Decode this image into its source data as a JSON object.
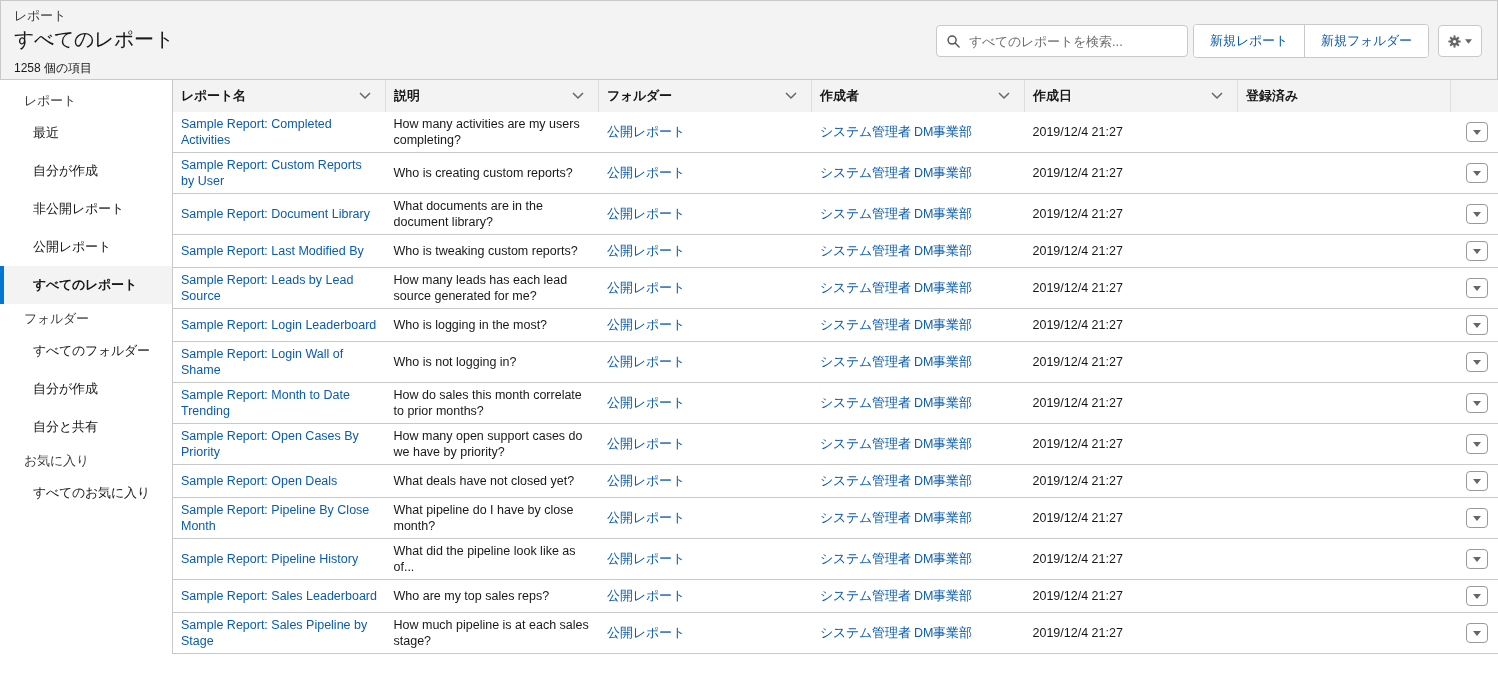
{
  "header": {
    "object_label": "レポート",
    "title": "すべてのレポート",
    "item_count": "1258 個の項目",
    "search": {
      "placeholder": "すべてのレポートを検索..."
    },
    "buttons": [
      "新規レポート",
      "新規フォルダー"
    ]
  },
  "sidebar": {
    "sections": [
      {
        "heading": "レポート",
        "items": [
          {
            "label": "最近",
            "selected": false
          },
          {
            "label": "自分が作成",
            "selected": false
          },
          {
            "label": "非公開レポート",
            "selected": false
          },
          {
            "label": "公開レポート",
            "selected": false
          },
          {
            "label": "すべてのレポート",
            "selected": true
          }
        ]
      },
      {
        "heading": "フォルダー",
        "items": [
          {
            "label": "すべてのフォルダー",
            "selected": false
          },
          {
            "label": "自分が作成",
            "selected": false
          },
          {
            "label": "自分と共有",
            "selected": false
          }
        ]
      },
      {
        "heading": "お気に入り",
        "items": [
          {
            "label": "すべてのお気に入り",
            "selected": false
          }
        ]
      }
    ]
  },
  "table": {
    "columns": [
      {
        "label": "レポート名",
        "sortable": true
      },
      {
        "label": "説明",
        "sortable": true
      },
      {
        "label": "フォルダー",
        "sortable": true
      },
      {
        "label": "作成者",
        "sortable": true
      },
      {
        "label": "作成日",
        "sortable": true
      },
      {
        "label": "登録済み",
        "sortable": false
      }
    ],
    "rows": [
      {
        "name": "Sample Report: Completed Activities",
        "description": "How many activities are my users completing?",
        "folder": "公開レポート",
        "created_by": "システム管理者 DM事業部",
        "created_date": "2019/12/4 21:27"
      },
      {
        "name": "Sample Report: Custom Reports by User",
        "description": "Who is creating custom reports?",
        "folder": "公開レポート",
        "created_by": "システム管理者 DM事業部",
        "created_date": "2019/12/4 21:27"
      },
      {
        "name": "Sample Report: Document Library",
        "description": "What documents are in the document library?",
        "folder": "公開レポート",
        "created_by": "システム管理者 DM事業部",
        "created_date": "2019/12/4 21:27"
      },
      {
        "name": "Sample Report: Last Modified By",
        "description": "Who is tweaking custom reports?",
        "folder": "公開レポート",
        "created_by": "システム管理者 DM事業部",
        "created_date": "2019/12/4 21:27"
      },
      {
        "name": "Sample Report: Leads by Lead Source",
        "description": "How many leads has each lead source generated for me?",
        "folder": "公開レポート",
        "created_by": "システム管理者 DM事業部",
        "created_date": "2019/12/4 21:27"
      },
      {
        "name": "Sample Report: Login Leaderboard",
        "description": "Who is logging in the most?",
        "folder": "公開レポート",
        "created_by": "システム管理者 DM事業部",
        "created_date": "2019/12/4 21:27"
      },
      {
        "name": "Sample Report: Login Wall of Shame",
        "description": "Who is not logging in?",
        "folder": "公開レポート",
        "created_by": "システム管理者 DM事業部",
        "created_date": "2019/12/4 21:27"
      },
      {
        "name": "Sample Report: Month to Date Trending",
        "description": "How do sales this month correlate to prior months?",
        "folder": "公開レポート",
        "created_by": "システム管理者 DM事業部",
        "created_date": "2019/12/4 21:27"
      },
      {
        "name": "Sample Report: Open Cases By Priority",
        "description": "How many open support cases do we have by priority?",
        "folder": "公開レポート",
        "created_by": "システム管理者 DM事業部",
        "created_date": "2019/12/4 21:27"
      },
      {
        "name": "Sample Report: Open Deals",
        "description": "What deals have not closed yet?",
        "folder": "公開レポート",
        "created_by": "システム管理者 DM事業部",
        "created_date": "2019/12/4 21:27"
      },
      {
        "name": "Sample Report: Pipeline By Close Month",
        "description": "What pipeline do I have by close month?",
        "folder": "公開レポート",
        "created_by": "システム管理者 DM事業部",
        "created_date": "2019/12/4 21:27"
      },
      {
        "name": "Sample Report: Pipeline History",
        "description": "What did the pipeline look like as of...",
        "folder": "公開レポート",
        "created_by": "システム管理者 DM事業部",
        "created_date": "2019/12/4 21:27"
      },
      {
        "name": "Sample Report: Sales Leaderboard",
        "description": "Who are my top sales reps?",
        "folder": "公開レポート",
        "created_by": "システム管理者 DM事業部",
        "created_date": "2019/12/4 21:27"
      },
      {
        "name": "Sample Report: Sales Pipeline by Stage",
        "description": "How much pipeline is at each sales stage?",
        "folder": "公開レポート",
        "created_by": "システム管理者 DM事業部",
        "created_date": "2019/12/4 21:27"
      }
    ]
  }
}
